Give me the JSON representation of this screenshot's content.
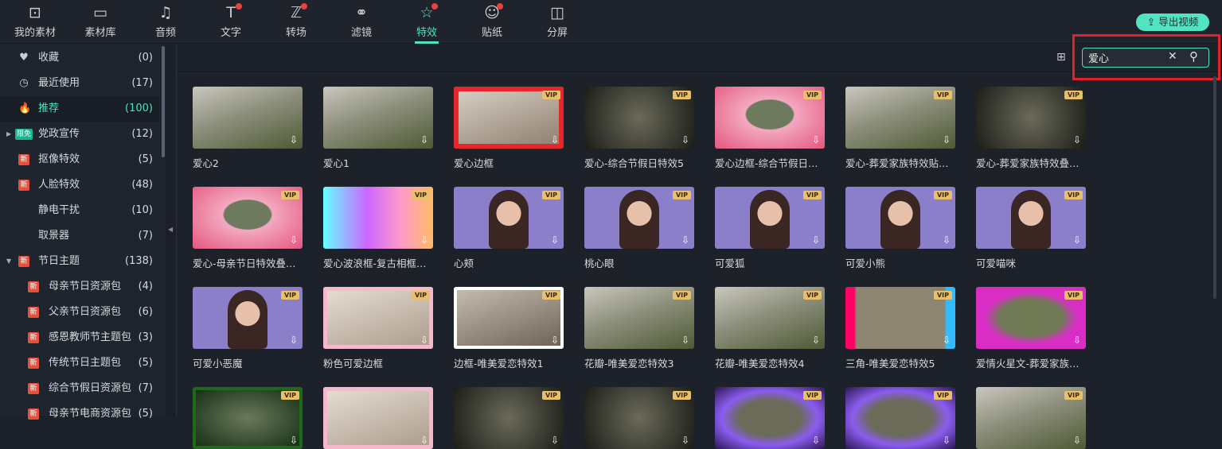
{
  "tabs": [
    {
      "label": "我的素材",
      "icon": "box-icon"
    },
    {
      "label": "素材库",
      "icon": "folder-icon"
    },
    {
      "label": "音频",
      "icon": "music-icon"
    },
    {
      "label": "文字",
      "icon": "text-icon",
      "dot": true
    },
    {
      "label": "转场",
      "icon": "transition-icon",
      "dot": true
    },
    {
      "label": "滤镜",
      "icon": "filter-icon"
    },
    {
      "label": "特效",
      "icon": "magic-wand-icon",
      "dot": true,
      "active": true
    },
    {
      "label": "贴纸",
      "icon": "sticker-icon",
      "dot": true
    },
    {
      "label": "分屏",
      "icon": "split-screen-icon"
    }
  ],
  "export_label": "导出视频",
  "sidebar": [
    {
      "label": "收藏",
      "count": "(0)",
      "icon": "heart-icon"
    },
    {
      "label": "最近使用",
      "count": "(17)",
      "icon": "clock-icon"
    },
    {
      "label": "推荐",
      "count": "(100)",
      "icon": "fire-icon",
      "active": true
    },
    {
      "label": "党政宣传",
      "count": "(12)",
      "badge": "限免",
      "arrow": "▶"
    },
    {
      "label": "抠像特效",
      "count": "(5)",
      "badge": "新"
    },
    {
      "label": "人脸特效",
      "count": "(48)",
      "badge": "新"
    },
    {
      "label": "静电干扰",
      "count": "(10)"
    },
    {
      "label": "取景器",
      "count": "(7)"
    },
    {
      "label": "节日主题",
      "count": "(138)",
      "badge": "新",
      "arrow": "▼"
    },
    {
      "label": "母亲节日资源包",
      "count": "(4)",
      "badge": "新",
      "sub": true
    },
    {
      "label": "父亲节日资源包",
      "count": "(6)",
      "badge": "新",
      "sub": true
    },
    {
      "label": "感恩教师节主题包",
      "count": "(3)",
      "badge": "新",
      "sub": true
    },
    {
      "label": "传统节日主题包",
      "count": "(5)",
      "badge": "新",
      "sub": true
    },
    {
      "label": "综合节假日资源包",
      "count": "(7)",
      "badge": "新",
      "sub": true
    },
    {
      "label": "母亲节电商资源包",
      "count": "(5)",
      "badge": "新",
      "sub": true
    }
  ],
  "search": {
    "value": "爱心"
  },
  "vip_label": "VIP",
  "items": [
    {
      "label": "爱心2",
      "vip": false,
      "style": "scene"
    },
    {
      "label": "爱心1",
      "vip": false,
      "style": "scene"
    },
    {
      "label": "爱心边框",
      "vip": true,
      "style": "red"
    },
    {
      "label": "爱心-综合节假日特效5",
      "vip": true,
      "style": "dark"
    },
    {
      "label": "爱心边框-综合节假日…",
      "vip": true,
      "style": "pinkheart"
    },
    {
      "label": "爱心-葬爱家族特效贴…",
      "vip": true,
      "style": "scene"
    },
    {
      "label": "爱心-葬爱家族特效叠…",
      "vip": true,
      "style": "dark"
    },
    {
      "label": "爱心-母亲节日特效叠…",
      "vip": true,
      "style": "pinkheart"
    },
    {
      "label": "爱心波浪框-复古相框…",
      "vip": true,
      "style": "rainbow"
    },
    {
      "label": "心颊",
      "vip": true,
      "style": "face"
    },
    {
      "label": "桃心眼",
      "vip": true,
      "style": "face"
    },
    {
      "label": "可爱狐",
      "vip": true,
      "style": "face"
    },
    {
      "label": "可爱小熊",
      "vip": true,
      "style": "face"
    },
    {
      "label": "可爱喵咪",
      "vip": true,
      "style": "face"
    },
    {
      "label": "可爱小恶魔",
      "vip": true,
      "style": "face"
    },
    {
      "label": "粉色可爱边框",
      "vip": true,
      "style": "pink"
    },
    {
      "label": "边框-唯美爱恋特效1",
      "vip": true,
      "style": "white"
    },
    {
      "label": "花瓣-唯美爱恋特效3",
      "vip": true,
      "style": "scene"
    },
    {
      "label": "花瓣-唯美爱恋特效4",
      "vip": true,
      "style": "scene"
    },
    {
      "label": "三角-唯美爱恋特效5",
      "vip": true,
      "style": "tri"
    },
    {
      "label": "爱情火星文-葬爱家族…",
      "vip": true,
      "style": "magenta"
    },
    {
      "label": "",
      "vip": true,
      "style": "green"
    },
    {
      "label": "",
      "vip": false,
      "style": "pink"
    },
    {
      "label": "",
      "vip": true,
      "style": "dark"
    },
    {
      "label": "",
      "vip": true,
      "style": "dark"
    },
    {
      "label": "",
      "vip": true,
      "style": "purple"
    },
    {
      "label": "",
      "vip": true,
      "style": "purple"
    },
    {
      "label": "",
      "vip": true,
      "style": "scene"
    }
  ]
}
